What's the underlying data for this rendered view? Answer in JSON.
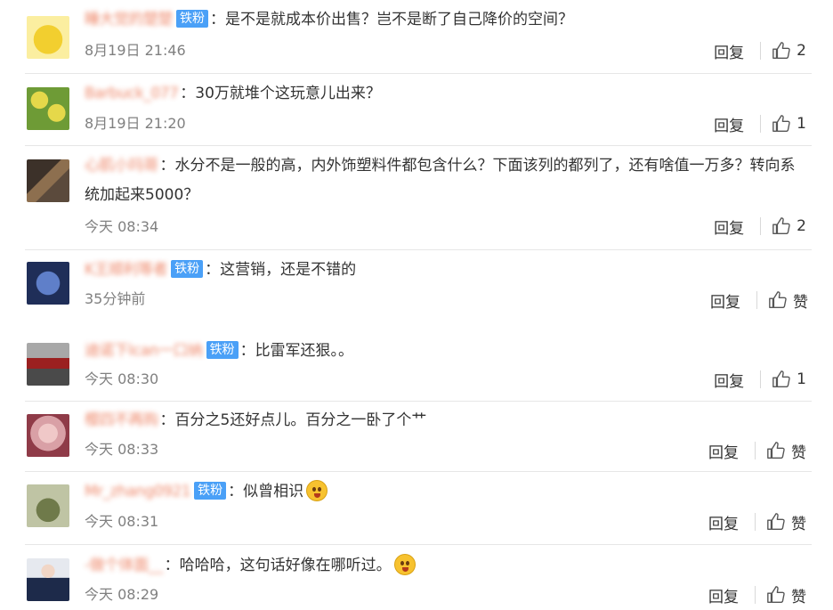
{
  "labels": {
    "reply": "回复",
    "like_empty": "赞",
    "badge": "铁粉"
  },
  "comments": [
    {
      "username": "睡大觉的楚楚",
      "badge": "铁粉",
      "text": "是不是就成本价出售？岂不是断了自己降价的空间？",
      "time": "8月19日 21:46",
      "likes": "2",
      "avatar": {
        "bg": "#fbeea0",
        "fg": "#f2cf2f",
        "desc": "pikachu"
      }
    },
    {
      "username": "Barbuck_077",
      "badge": "",
      "text": "30万就堆个这玩意儿出来？",
      "time": "8月19日 21:20",
      "likes": "1",
      "avatar": {
        "bg": "#c7c33a",
        "fg": "#6e9b36",
        "desc": "flowers"
      }
    },
    {
      "username": "心肌小玛哥",
      "badge": "",
      "text": "水分不是一般的高，内外饰塑料件都包含什么？下面该列的都列了，还有啥值一万多？转向系统加起来5000？",
      "time": "今天 08:34",
      "likes": "2",
      "avatar": {
        "bg": "#5b4a3c",
        "fg": "#8d6f4f",
        "desc": "photo"
      }
    },
    {
      "username": "K王顺利等者",
      "badge": "铁粉",
      "text": "这营销，还是不错的",
      "time": "35分钟前",
      "likes": "赞",
      "avatar": {
        "bg": "#1f2e58",
        "fg": "#5f7fc9",
        "desc": "planet"
      }
    },
    {
      "username": "迪诺下Ican一口纳",
      "badge": "铁粉",
      "text": "比雷军还狠。。",
      "time": "今天 08:30",
      "likes": "1",
      "avatar": {
        "bg": "#6c6c6c",
        "fg": "#9b2020",
        "desc": "car"
      }
    },
    {
      "username": "樱四不再购",
      "badge": "",
      "text": "百分之5还好点儿。百分之一卧了个艹",
      "time": "今天 08:33",
      "likes": "赞",
      "avatar": {
        "bg": "#d9a0a6",
        "fg": "#8f3b48",
        "desc": "face"
      }
    },
    {
      "username": "Mr_zhang0921",
      "badge": "铁粉",
      "text": "似曾相识",
      "emoji": "doge-emoji",
      "time": "今天 08:31",
      "likes": "赞",
      "avatar": {
        "bg": "#bfc4a4",
        "fg": "#6f7a4a",
        "desc": "toy"
      }
    },
    {
      "username": "-做个体面__",
      "badge": "",
      "text": "哈哈哈，这句话好像在哪听过。",
      "emoji": "laugh-emoji",
      "time": "今天 08:29",
      "likes": "赞",
      "avatar": {
        "bg": "#e6e9ef",
        "fg": "#1d2a4a",
        "desc": "uniform"
      }
    }
  ]
}
